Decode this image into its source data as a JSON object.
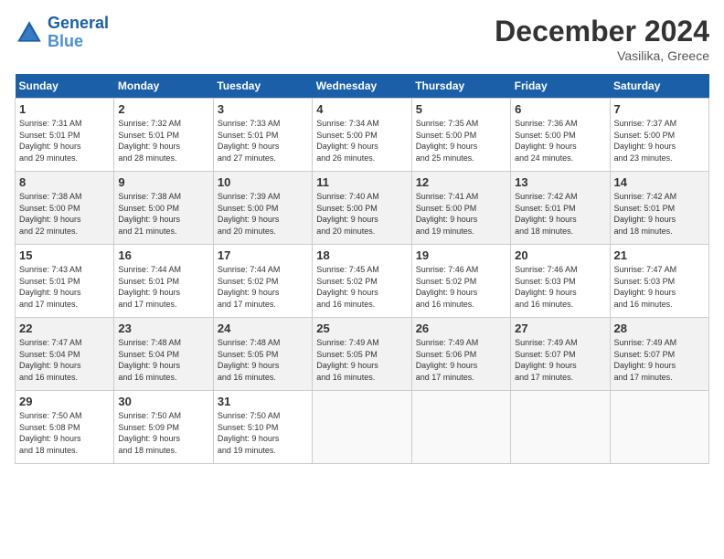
{
  "header": {
    "logo_line1": "General",
    "logo_line2": "Blue",
    "month": "December 2024",
    "location": "Vasilika, Greece"
  },
  "weekdays": [
    "Sunday",
    "Monday",
    "Tuesday",
    "Wednesday",
    "Thursday",
    "Friday",
    "Saturday"
  ],
  "weeks": [
    [
      {
        "day": "1",
        "info": "Sunrise: 7:31 AM\nSunset: 5:01 PM\nDaylight: 9 hours\nand 29 minutes."
      },
      {
        "day": "2",
        "info": "Sunrise: 7:32 AM\nSunset: 5:01 PM\nDaylight: 9 hours\nand 28 minutes."
      },
      {
        "day": "3",
        "info": "Sunrise: 7:33 AM\nSunset: 5:01 PM\nDaylight: 9 hours\nand 27 minutes."
      },
      {
        "day": "4",
        "info": "Sunrise: 7:34 AM\nSunset: 5:00 PM\nDaylight: 9 hours\nand 26 minutes."
      },
      {
        "day": "5",
        "info": "Sunrise: 7:35 AM\nSunset: 5:00 PM\nDaylight: 9 hours\nand 25 minutes."
      },
      {
        "day": "6",
        "info": "Sunrise: 7:36 AM\nSunset: 5:00 PM\nDaylight: 9 hours\nand 24 minutes."
      },
      {
        "day": "7",
        "info": "Sunrise: 7:37 AM\nSunset: 5:00 PM\nDaylight: 9 hours\nand 23 minutes."
      }
    ],
    [
      {
        "day": "8",
        "info": "Sunrise: 7:38 AM\nSunset: 5:00 PM\nDaylight: 9 hours\nand 22 minutes."
      },
      {
        "day": "9",
        "info": "Sunrise: 7:38 AM\nSunset: 5:00 PM\nDaylight: 9 hours\nand 21 minutes."
      },
      {
        "day": "10",
        "info": "Sunrise: 7:39 AM\nSunset: 5:00 PM\nDaylight: 9 hours\nand 20 minutes."
      },
      {
        "day": "11",
        "info": "Sunrise: 7:40 AM\nSunset: 5:00 PM\nDaylight: 9 hours\nand 20 minutes."
      },
      {
        "day": "12",
        "info": "Sunrise: 7:41 AM\nSunset: 5:00 PM\nDaylight: 9 hours\nand 19 minutes."
      },
      {
        "day": "13",
        "info": "Sunrise: 7:42 AM\nSunset: 5:01 PM\nDaylight: 9 hours\nand 18 minutes."
      },
      {
        "day": "14",
        "info": "Sunrise: 7:42 AM\nSunset: 5:01 PM\nDaylight: 9 hours\nand 18 minutes."
      }
    ],
    [
      {
        "day": "15",
        "info": "Sunrise: 7:43 AM\nSunset: 5:01 PM\nDaylight: 9 hours\nand 17 minutes."
      },
      {
        "day": "16",
        "info": "Sunrise: 7:44 AM\nSunset: 5:01 PM\nDaylight: 9 hours\nand 17 minutes."
      },
      {
        "day": "17",
        "info": "Sunrise: 7:44 AM\nSunset: 5:02 PM\nDaylight: 9 hours\nand 17 minutes."
      },
      {
        "day": "18",
        "info": "Sunrise: 7:45 AM\nSunset: 5:02 PM\nDaylight: 9 hours\nand 16 minutes."
      },
      {
        "day": "19",
        "info": "Sunrise: 7:46 AM\nSunset: 5:02 PM\nDaylight: 9 hours\nand 16 minutes."
      },
      {
        "day": "20",
        "info": "Sunrise: 7:46 AM\nSunset: 5:03 PM\nDaylight: 9 hours\nand 16 minutes."
      },
      {
        "day": "21",
        "info": "Sunrise: 7:47 AM\nSunset: 5:03 PM\nDaylight: 9 hours\nand 16 minutes."
      }
    ],
    [
      {
        "day": "22",
        "info": "Sunrise: 7:47 AM\nSunset: 5:04 PM\nDaylight: 9 hours\nand 16 minutes."
      },
      {
        "day": "23",
        "info": "Sunrise: 7:48 AM\nSunset: 5:04 PM\nDaylight: 9 hours\nand 16 minutes."
      },
      {
        "day": "24",
        "info": "Sunrise: 7:48 AM\nSunset: 5:05 PM\nDaylight: 9 hours\nand 16 minutes."
      },
      {
        "day": "25",
        "info": "Sunrise: 7:49 AM\nSunset: 5:05 PM\nDaylight: 9 hours\nand 16 minutes."
      },
      {
        "day": "26",
        "info": "Sunrise: 7:49 AM\nSunset: 5:06 PM\nDaylight: 9 hours\nand 17 minutes."
      },
      {
        "day": "27",
        "info": "Sunrise: 7:49 AM\nSunset: 5:07 PM\nDaylight: 9 hours\nand 17 minutes."
      },
      {
        "day": "28",
        "info": "Sunrise: 7:49 AM\nSunset: 5:07 PM\nDaylight: 9 hours\nand 17 minutes."
      }
    ],
    [
      {
        "day": "29",
        "info": "Sunrise: 7:50 AM\nSunset: 5:08 PM\nDaylight: 9 hours\nand 18 minutes."
      },
      {
        "day": "30",
        "info": "Sunrise: 7:50 AM\nSunset: 5:09 PM\nDaylight: 9 hours\nand 18 minutes."
      },
      {
        "day": "31",
        "info": "Sunrise: 7:50 AM\nSunset: 5:10 PM\nDaylight: 9 hours\nand 19 minutes."
      },
      {
        "day": "",
        "info": ""
      },
      {
        "day": "",
        "info": ""
      },
      {
        "day": "",
        "info": ""
      },
      {
        "day": "",
        "info": ""
      }
    ]
  ]
}
